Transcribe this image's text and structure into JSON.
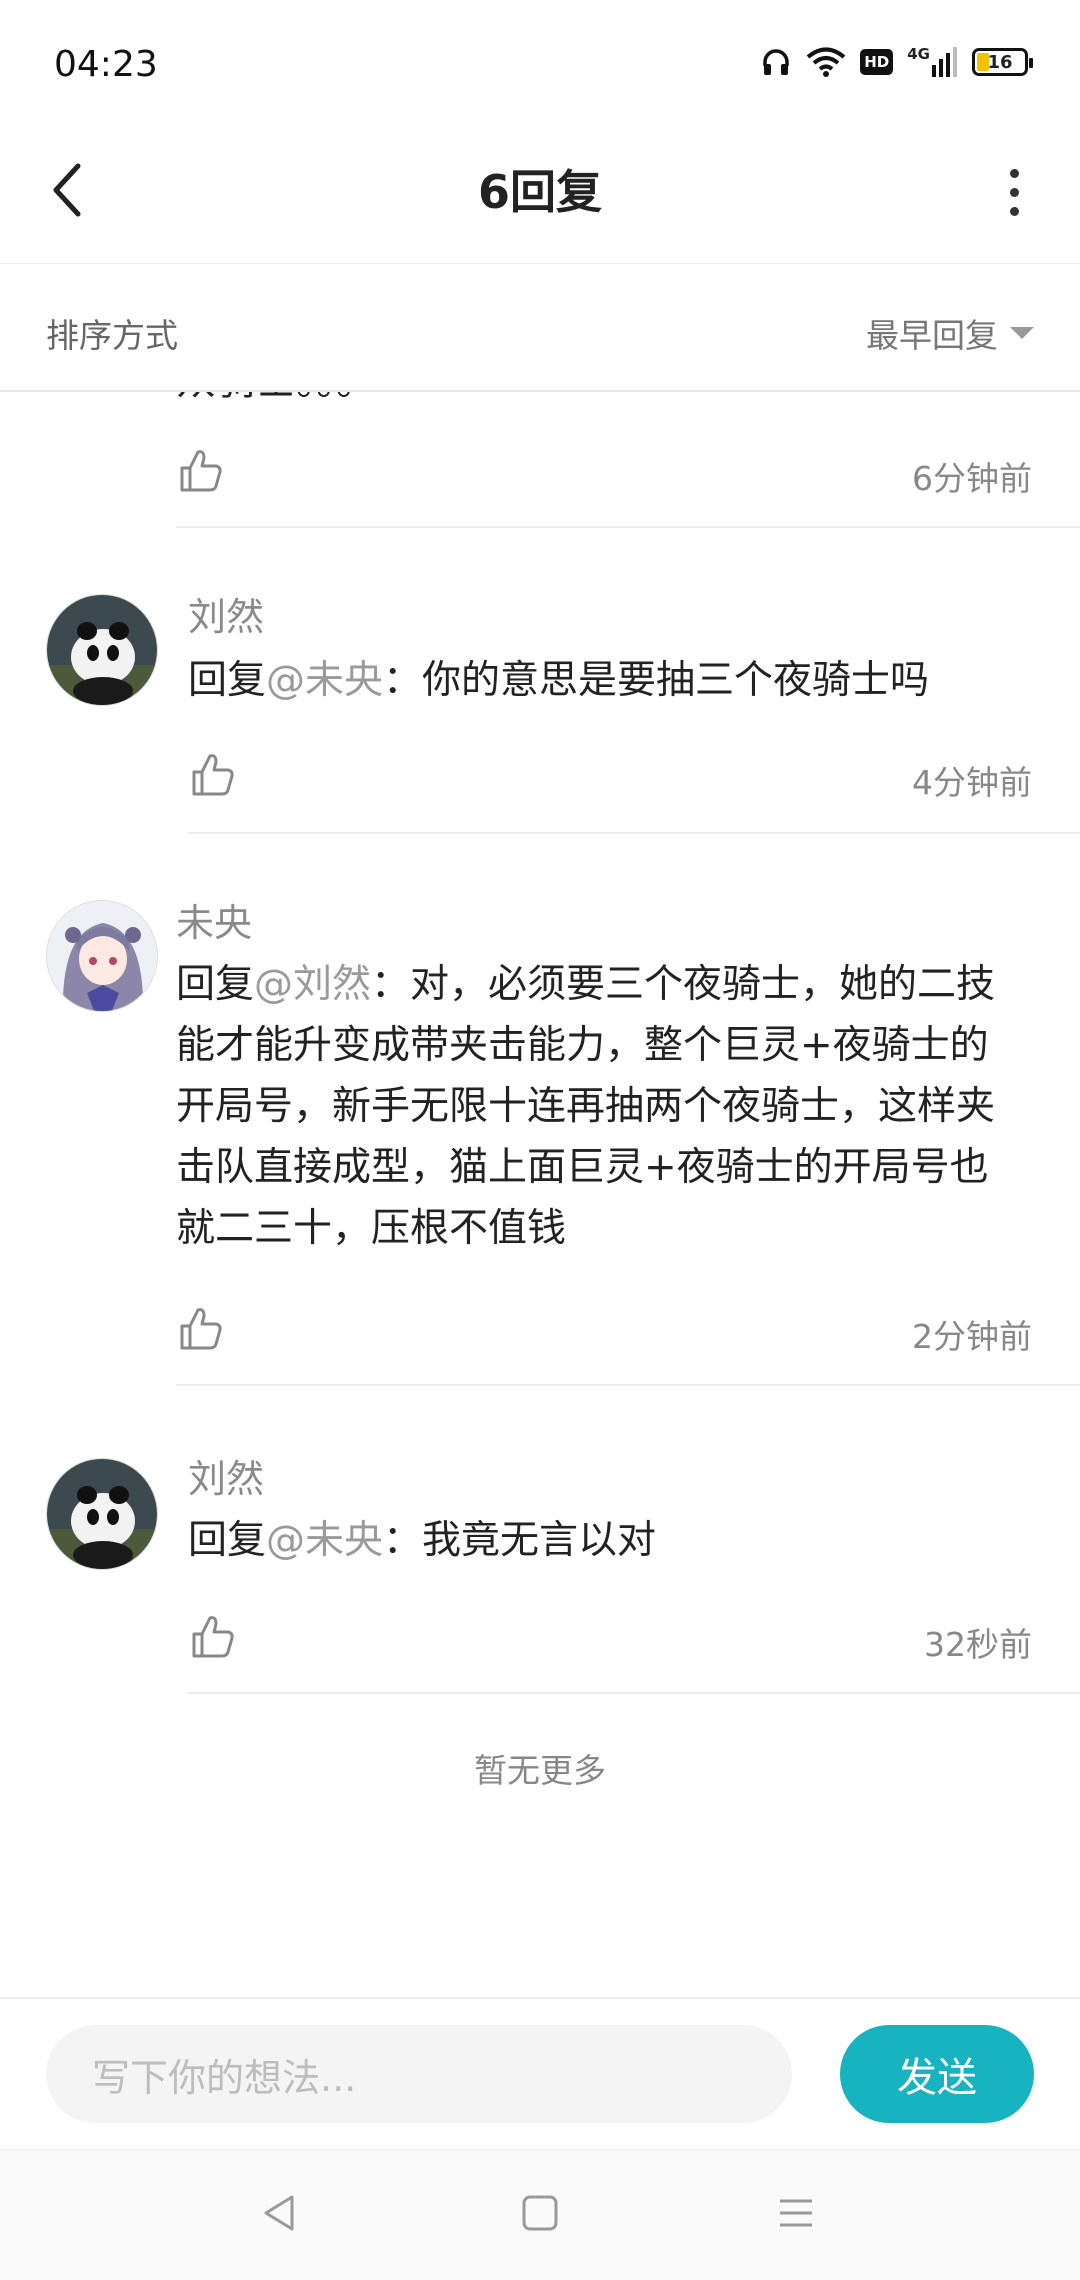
{
  "status_bar": {
    "time": "04:23",
    "network": "4G",
    "hd": "HD",
    "battery": "16",
    "icons": [
      "headphones-icon",
      "wifi-icon",
      "hd-icon",
      "signal-4g-icon",
      "battery-icon"
    ]
  },
  "header": {
    "title": "6回复",
    "back_icon": "chevron-left-icon",
    "more_icon": "more-vertical-icon"
  },
  "sort": {
    "label": "排序方式",
    "selected": "最早回复"
  },
  "partial_comment": {
    "text_fragment": "众骑士。。。",
    "time": "6分钟前"
  },
  "comments": [
    {
      "author": "刘然",
      "reply_prefix": "回复",
      "mention": "@未央",
      "separator": "：",
      "text": "你的意思是要抽三个夜骑士吗",
      "time": "4分钟前"
    },
    {
      "author": "未央",
      "reply_prefix": "回复",
      "mention": "@刘然",
      "separator": "：",
      "text": "对，必须要三个夜骑士，她的二技能才能升变成带夹击能力，整个巨灵+夜骑士的开局号，新手无限十连再抽两个夜骑士，这样夹击队直接成型，猫上面巨灵+夜骑士的开局号也就二三十，压根不值钱",
      "time": "2分钟前"
    },
    {
      "author": "刘然",
      "reply_prefix": "回复",
      "mention": "@未央",
      "separator": "：",
      "text": "我竟无言以对",
      "time": "32秒前"
    }
  ],
  "footer_note": "暂无更多",
  "input": {
    "placeholder": "写下你的想法...",
    "send_label": "发送"
  },
  "colors": {
    "accent": "#17b3c0",
    "muted_text": "#888888",
    "body_text": "#222222"
  }
}
